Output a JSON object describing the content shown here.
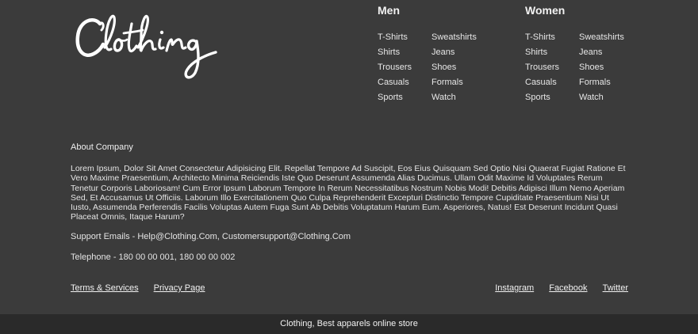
{
  "brand": {
    "logo_text": "Clothing"
  },
  "categories": {
    "men": {
      "title": "Men",
      "items": [
        "T-Shirts",
        "Sweatshirts",
        "Shirts",
        "Jeans",
        "Trousers",
        "Shoes",
        "Casuals",
        "Formals",
        "Sports",
        "Watch"
      ]
    },
    "women": {
      "title": "Women",
      "items": [
        "T-Shirts",
        "Sweatshirts",
        "Shirts",
        "Jeans",
        "Trousers",
        "Shoes",
        "Casuals",
        "Formals",
        "Sports",
        "Watch"
      ]
    }
  },
  "about": {
    "title": "About Company",
    "text": "Lorem Ipsum, Dolor Sit Amet Consectetur Adipisicing Elit. Repellat Tempore Ad Suscipit, Eos Eius Quisquam Sed Optio Nisi Quaerat Fugiat Ratione Et Vero Maxime Praesentium, Architecto Minima Reiciendis Iste Quo Deserunt Assumenda Alias Ducimus. Ullam Odit Maxime Id Voluptates Rerum Tenetur Corporis Laboriosam! Cum Error Ipsum Laborum Tempore In Rerum Necessitatibus Nostrum Nobis Modi! Debitis Adipisci Illum Nemo Aperiam Sed, Et Accusamus Ut Officiis. Laborum Illo Exercitationem Quo Culpa Reprehenderit Excepturi Distinctio Tempore Cupiditate Praesentium Nisi Ut Iusto, Assumenda Perferendis Facilis Voluptas Autem Fuga Sunt Ab Debitis Voluptatum Harum Eum. Asperiores, Natus! Est Deserunt Incidunt Quasi Placeat Omnis, Itaque Harum?",
    "emails": "Support Emails - Help@Clothing.Com, Customersupport@Clothing.Com",
    "phone": "Telephone - 180 00 00 001, 180 00 00 002"
  },
  "links": {
    "terms": "Terms & Services",
    "privacy": "Privacy Page",
    "instagram": "Instagram",
    "facebook": "Facebook",
    "twitter": "Twitter"
  },
  "copyright": "Clothing, Best apparels online store",
  "colors": {
    "background": "#3b3b3b",
    "bottom_bar": "#2a2a2a",
    "text": "#e8e8e8"
  }
}
